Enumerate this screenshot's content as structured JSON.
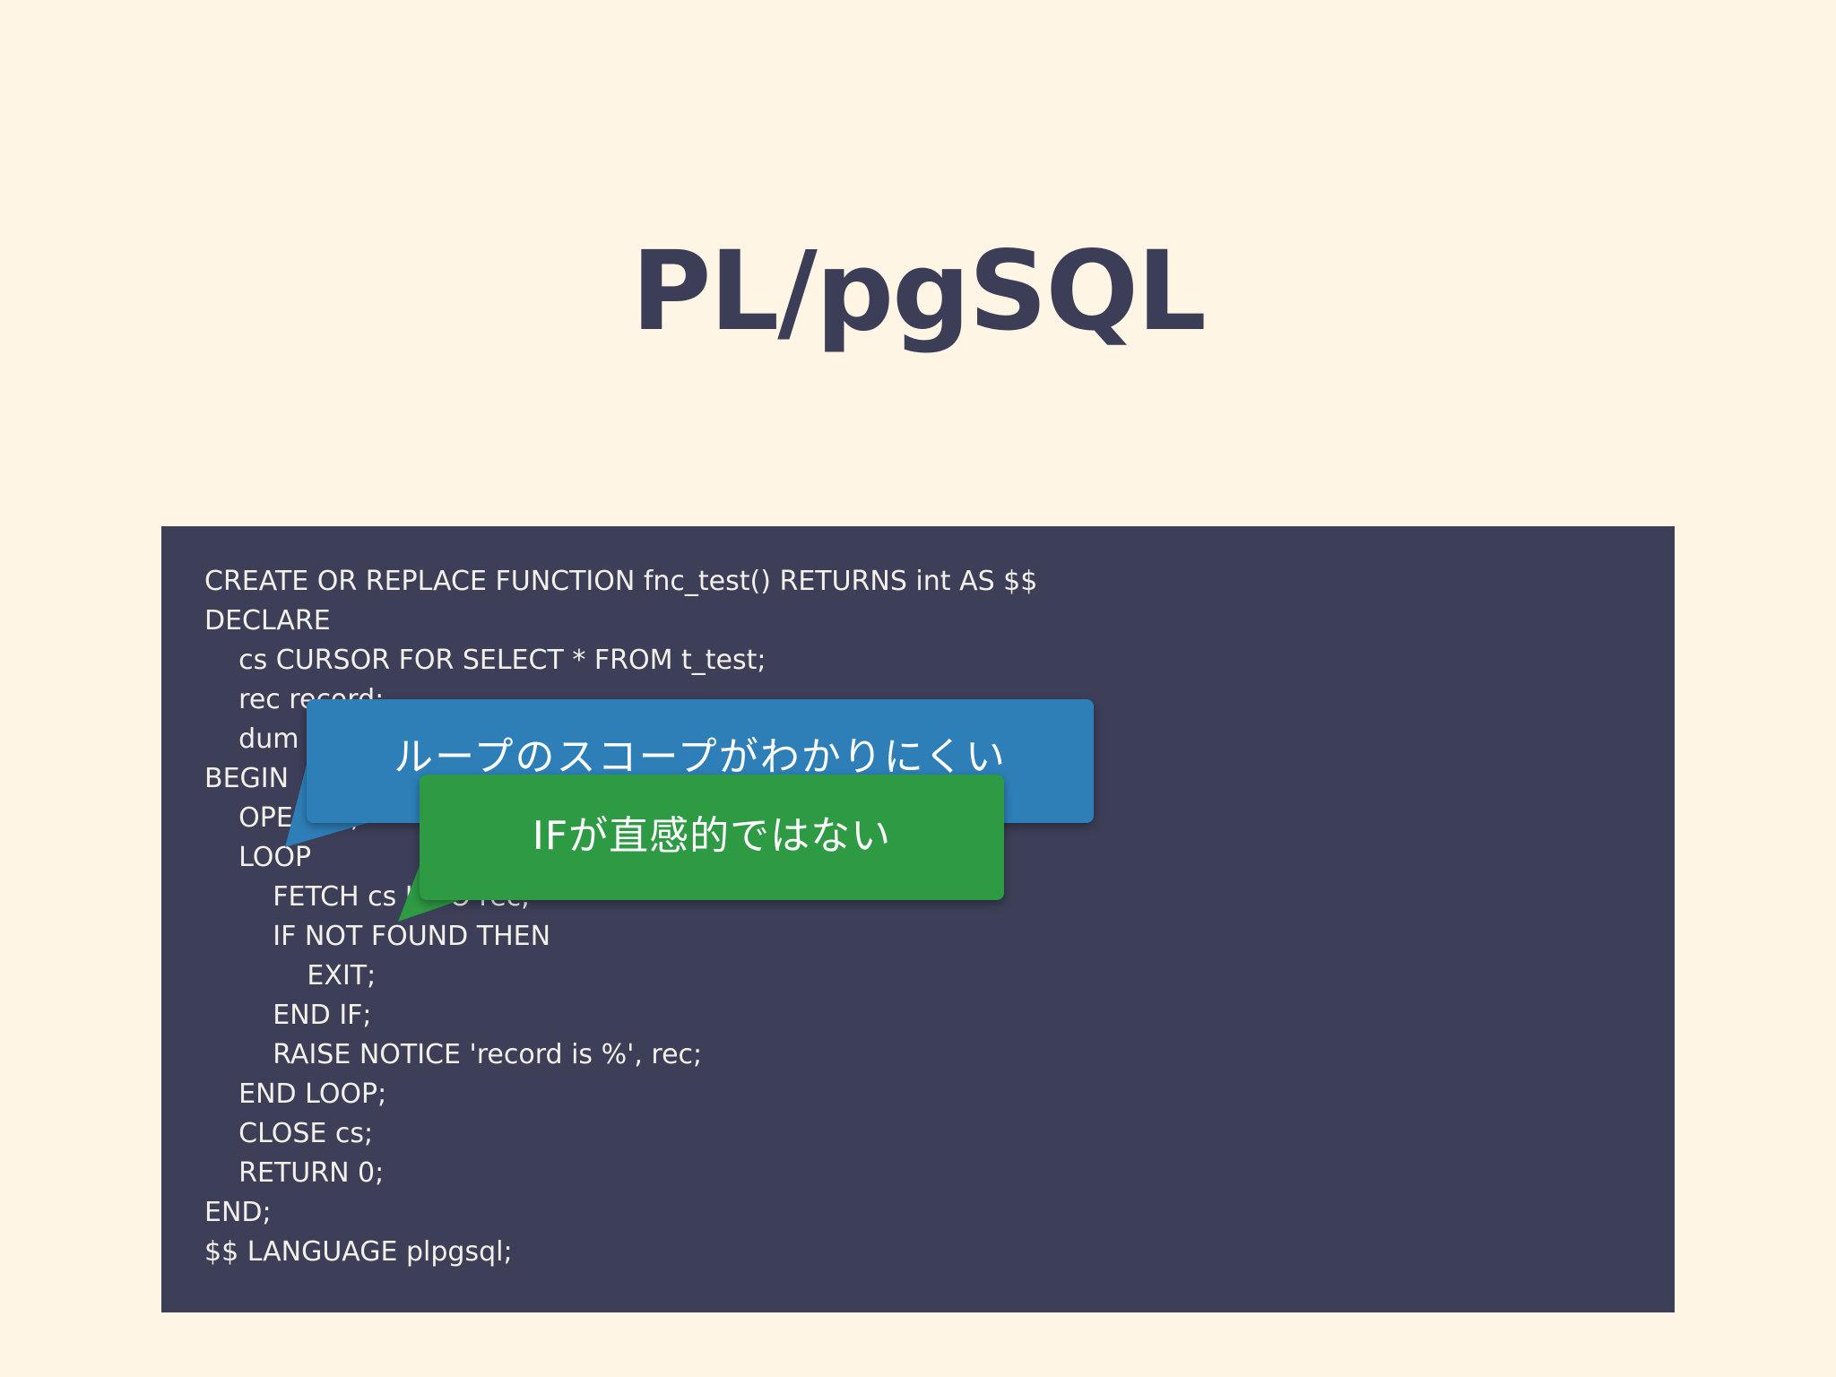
{
  "title": "PL/pgSQL",
  "code": {
    "lines": [
      "CREATE OR REPLACE FUNCTION fnc_test() RETURNS int AS $$",
      "DECLARE",
      "    cs CURSOR FOR SELECT * FROM t_test;",
      "    rec record;",
      "    dum d",
      "BEGIN",
      "    OPEN cs;",
      "    LOOP",
      "        FETCH cs INTO rec;",
      "        IF NOT FOUND THEN",
      "            EXIT;",
      "        END IF;",
      "        RAISE NOTICE 'record is %', rec;",
      "    END LOOP;",
      "    CLOSE cs;",
      "    RETURN 0;",
      "END;",
      "$$ LANGUAGE plpgsql;"
    ]
  },
  "callouts": {
    "loop_scope": "ループのスコープがわかりにくい",
    "if_intuitive": "IFが直感的ではない"
  },
  "colors": {
    "background": "#fff5e5",
    "title": "#3c3e58",
    "code_panel": "#3d3f59",
    "code_text": "#f3f0ea",
    "callout_blue": "#2e7fb8",
    "callout_green": "#2e9a44"
  }
}
